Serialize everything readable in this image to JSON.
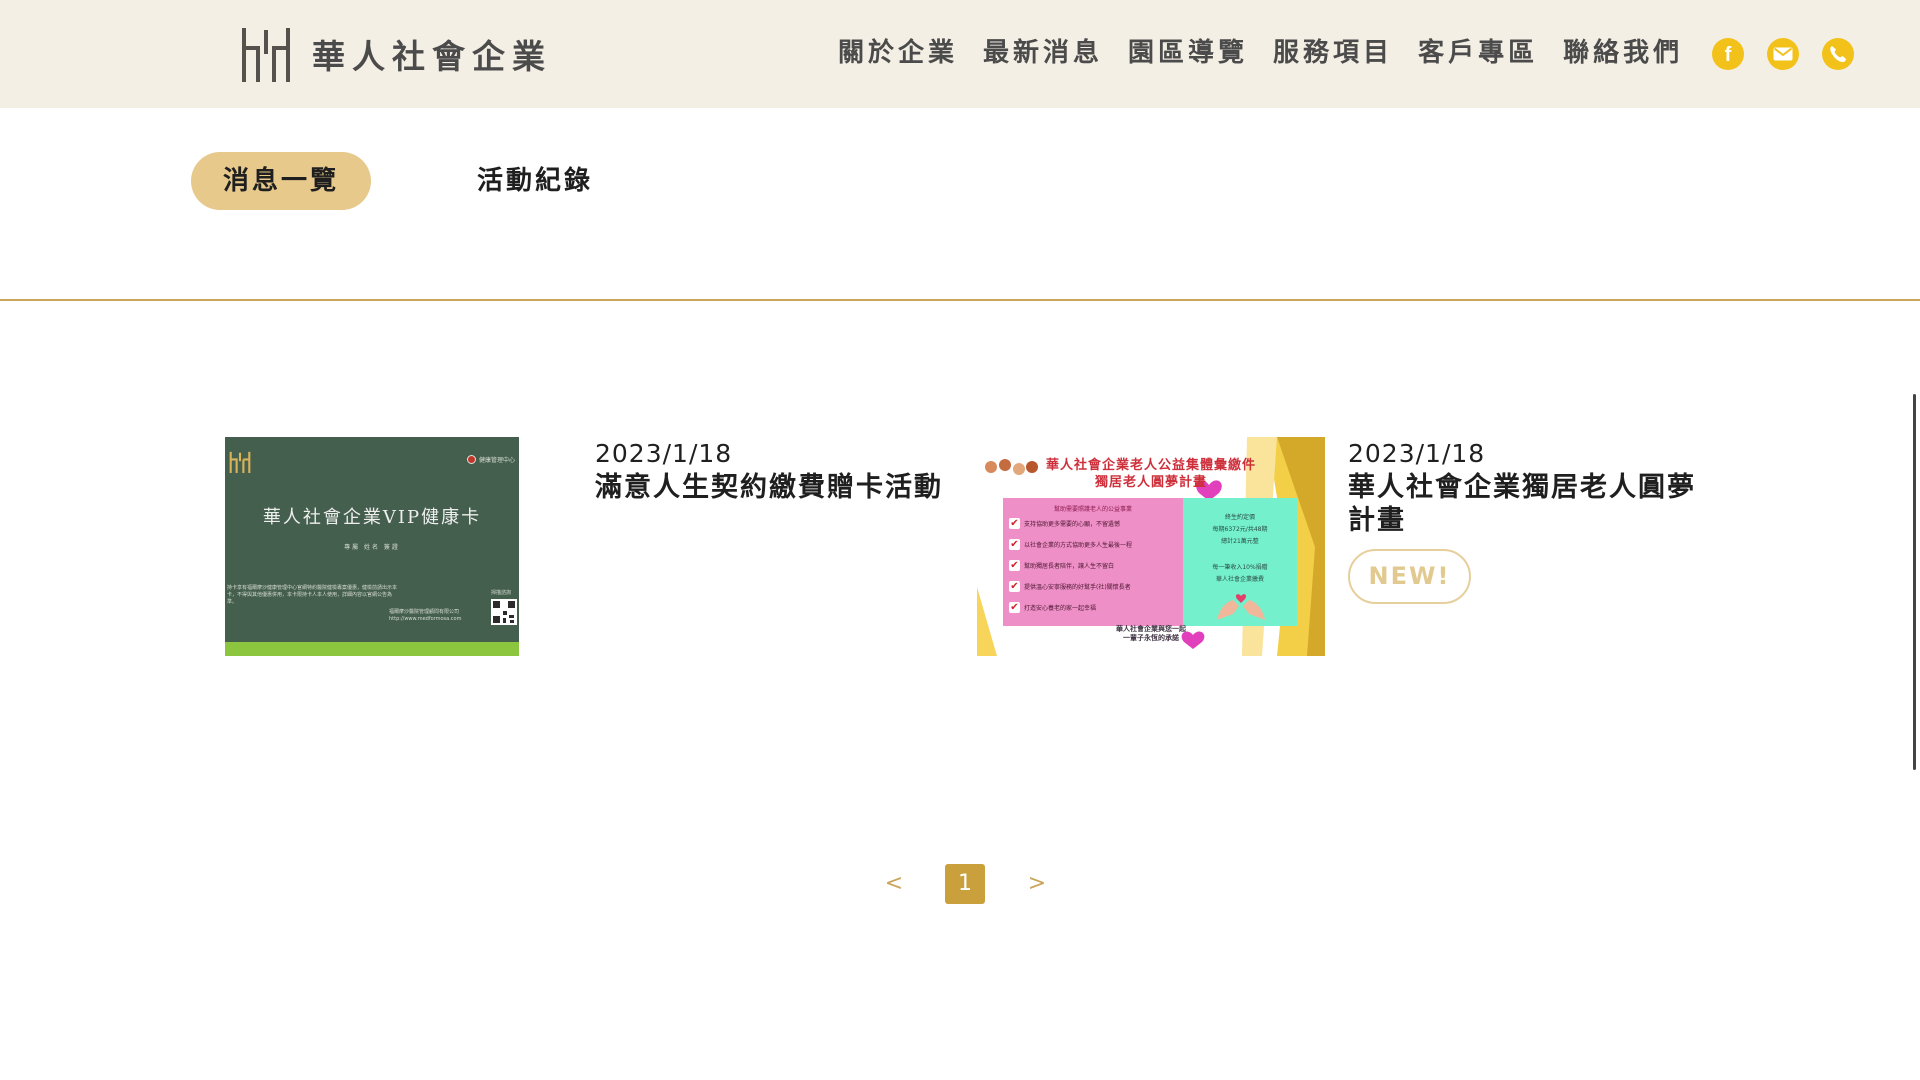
{
  "header": {
    "brand_name": "華人社會企業",
    "logo_icon": "brand-mark-icon",
    "nav": [
      {
        "label": "關於企業"
      },
      {
        "label": "最新消息"
      },
      {
        "label": "園區導覽"
      },
      {
        "label": "服務項目"
      },
      {
        "label": "客戶專區"
      },
      {
        "label": "聯絡我們"
      }
    ],
    "social": [
      {
        "icon": "facebook-icon",
        "letter": "f"
      },
      {
        "icon": "mail-icon"
      },
      {
        "icon": "phone-icon"
      }
    ],
    "accent_color": "#f2c21b",
    "background_color": "#f4efe5"
  },
  "tabs": [
    {
      "label": "消息一覽",
      "active": true
    },
    {
      "label": "活動紀錄",
      "active": false
    }
  ],
  "news": [
    {
      "date": "2023/1/18",
      "title": "滿意人生契約繳費贈卡活動",
      "thumbnail": {
        "title": "華人社會企業VIP健康卡",
        "subtitle": "專屬 姓名 簽證",
        "fine_print": "持卡享有福爾摩沙健康管理中心官網特約醫院健檢專案優惠，健檢前請出示本卡，不得與其他優惠併用，本卡限持卡人本人使用，詳細內容以官網公告為準。",
        "company": "福爾摩沙醫院管理顧問有限公司",
        "url": "http://www.medformosa.com",
        "qr_label": "掃描諮詢",
        "partner": "健康管理中心"
      }
    },
    {
      "date": "2023/1/18",
      "title": "華人社會企業獨居老人圓夢計畫",
      "badge": "NEW!",
      "thumbnail": {
        "headline": "華人社會企業老人公益集體彙繳件",
        "headline2": "獨居老人圓夢計畫",
        "pink_title": "幫助需要照護老人的公益事業",
        "items": [
          "支持協助更多需要的心願，不留遺憾",
          "以社會企業的方式協助更多人生最後一程",
          "幫助獨居長者陪伴，讓人生不留白",
          "提供溫心安寧服務的好幫手(社)關懷長者",
          "打造安心養老的家一起幸福"
        ],
        "green_lines": [
          "終生約定價",
          "每期6372元/共48期",
          "總計21萬元整",
          "每一筆收入10%捐贈",
          "華人社會企業繳費"
        ],
        "footer": [
          "華人社會企業與您一起",
          "一輩子永恆的承諾"
        ]
      }
    }
  ],
  "pagination": {
    "prev": "<",
    "current": "1",
    "next": ">",
    "active_color": "#c9a03b"
  }
}
